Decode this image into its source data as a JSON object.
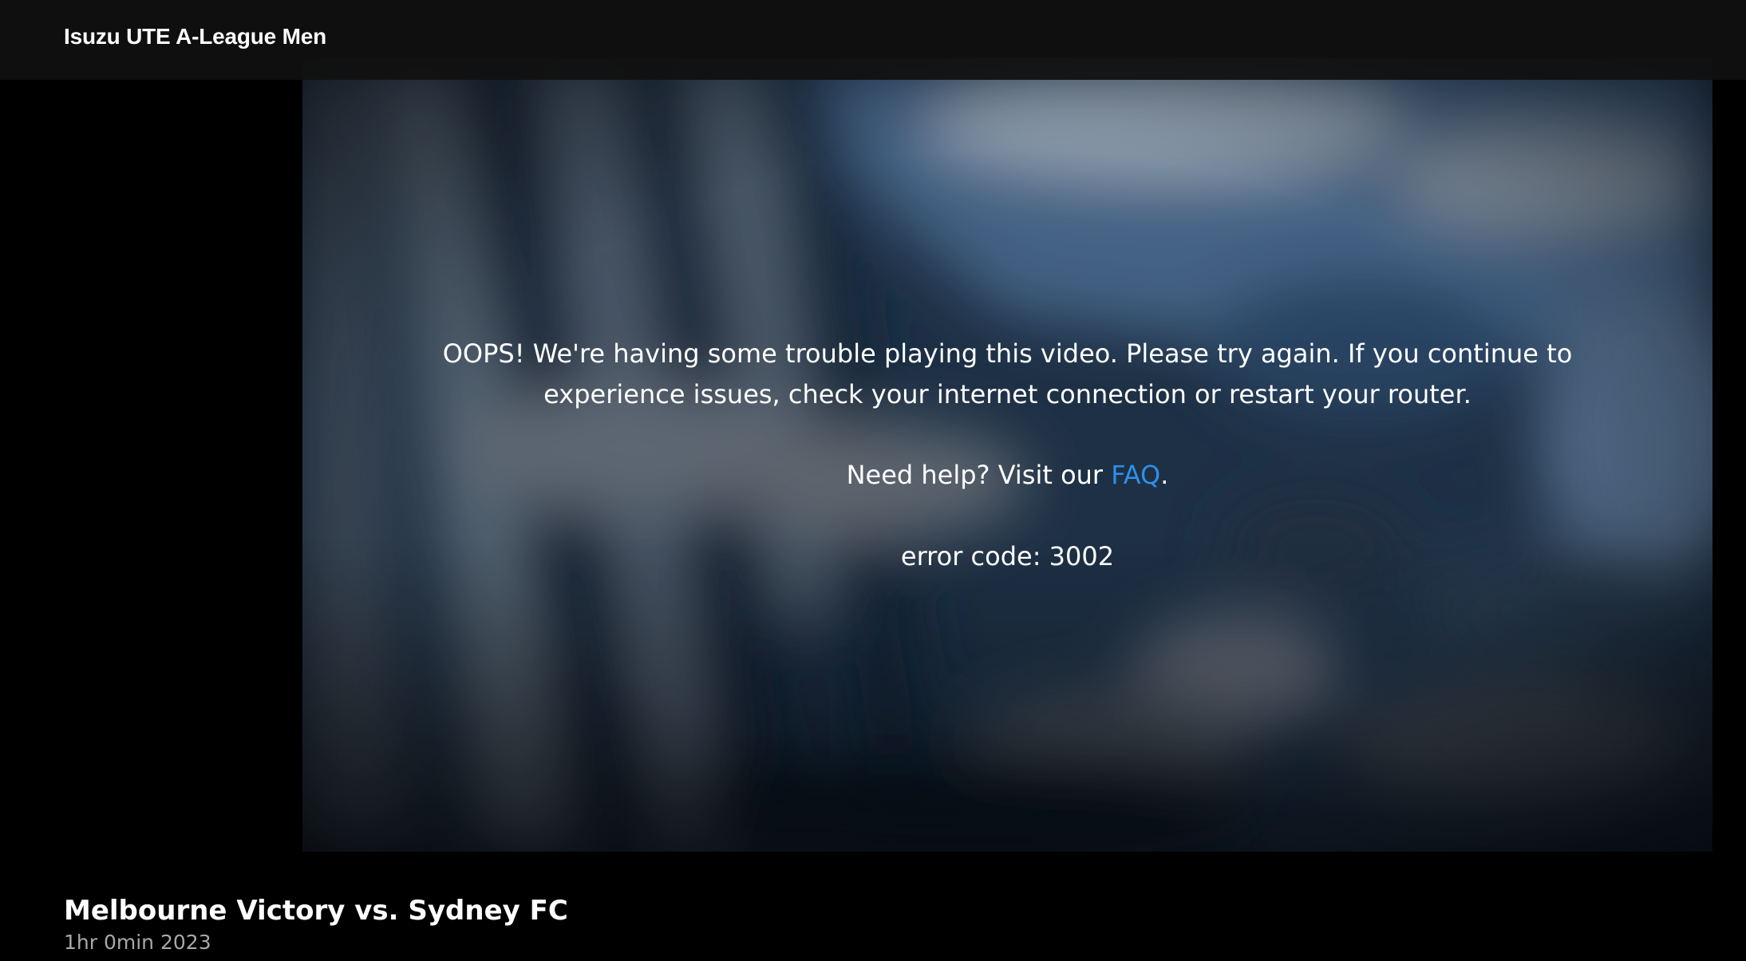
{
  "header": {
    "brand": "Isuzu UTE A-League Men"
  },
  "player": {
    "error_line_1": "OOPS! We're having some trouble playing this video. Please try again. If you continue to",
    "error_line_2": "experience issues, check your internet connection or restart your router.",
    "help_prefix": "Need help? Visit our ",
    "help_link": "FAQ",
    "help_suffix": ".",
    "error_code": "error code: 3002"
  },
  "video": {
    "title": "Melbourne Victory vs. Sydney FC",
    "subtitle": "1hr 0min 2023"
  },
  "colors": {
    "background": "#000000",
    "link": "#2f8fe8",
    "subtitle": "#a8a8a8"
  }
}
